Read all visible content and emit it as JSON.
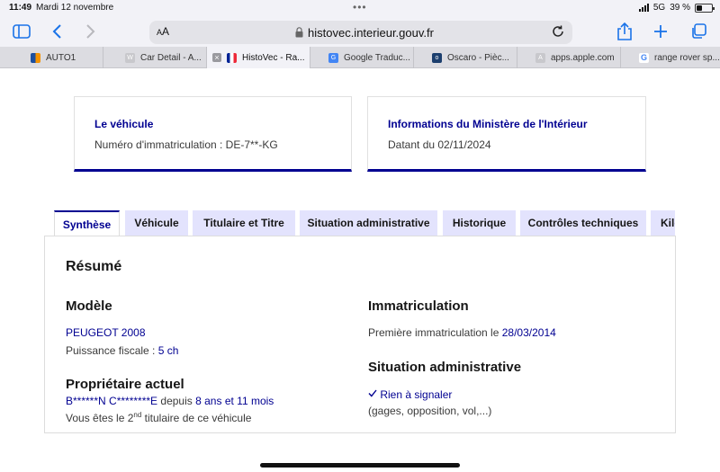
{
  "status": {
    "time": "11:49",
    "date": "Mardi 12 novembre",
    "network": "5G",
    "battery": "39 %"
  },
  "browser": {
    "address_aa_small": "A",
    "address_aa_large": "A",
    "url": "histovec.interieur.gouv.fr",
    "tabs": [
      {
        "title": "AUTO1",
        "favicon": "auto1-logo"
      },
      {
        "title": "Car Detail - A...",
        "favicon": "w-logo"
      },
      {
        "title": "HistoVec - Ra...",
        "favicon": "french-flag-icon",
        "active": true
      },
      {
        "title": "Google Traduc...",
        "favicon": "google-translate-icon"
      },
      {
        "title": "Oscaro - Pièc...",
        "favicon": "oscaro-icon"
      },
      {
        "title": "apps.apple.com",
        "favicon": "a-letter-icon"
      },
      {
        "title": "range rover sp...",
        "favicon": "google-g-icon"
      }
    ]
  },
  "cards": {
    "vehicle": {
      "title": "Le véhicule",
      "text": "Numéro d'immatriculation : DE-7**-KG"
    },
    "ministry": {
      "title": "Informations du Ministère de l'Intérieur",
      "text": "Datant du 02/11/2024"
    }
  },
  "page_tabs": [
    "Synthèse",
    "Véhicule",
    "Titulaire et Titre",
    "Situation administrative",
    "Historique",
    "Contrôles techniques",
    "Kilo"
  ],
  "summary": {
    "title": "Résumé",
    "model": {
      "heading": "Modèle",
      "name": "PEUGEOT 2008",
      "power_label": "Puissance fiscale :",
      "power_value": "5 ch"
    },
    "owner": {
      "heading": "Propriétaire actuel",
      "name": "B******N C********E",
      "since_label": "depuis",
      "since_value": "8 ans et 11 mois",
      "rank_prefix": "Vous êtes le",
      "rank_num": "2",
      "rank_sup": "nd",
      "rank_suffix": "titulaire de ce véhicule"
    },
    "registration": {
      "heading": "Immatriculation",
      "label": "Première immatriculation le",
      "date": "28/03/2014"
    },
    "admin": {
      "heading": "Situation administrative",
      "status": "Rien à signaler",
      "detail": "(gages, opposition, vol,...)"
    }
  },
  "colors": {
    "brand_blue": "#000091",
    "tab_bg": "#e3e3fd",
    "safari_blue": "#1a73e8"
  }
}
